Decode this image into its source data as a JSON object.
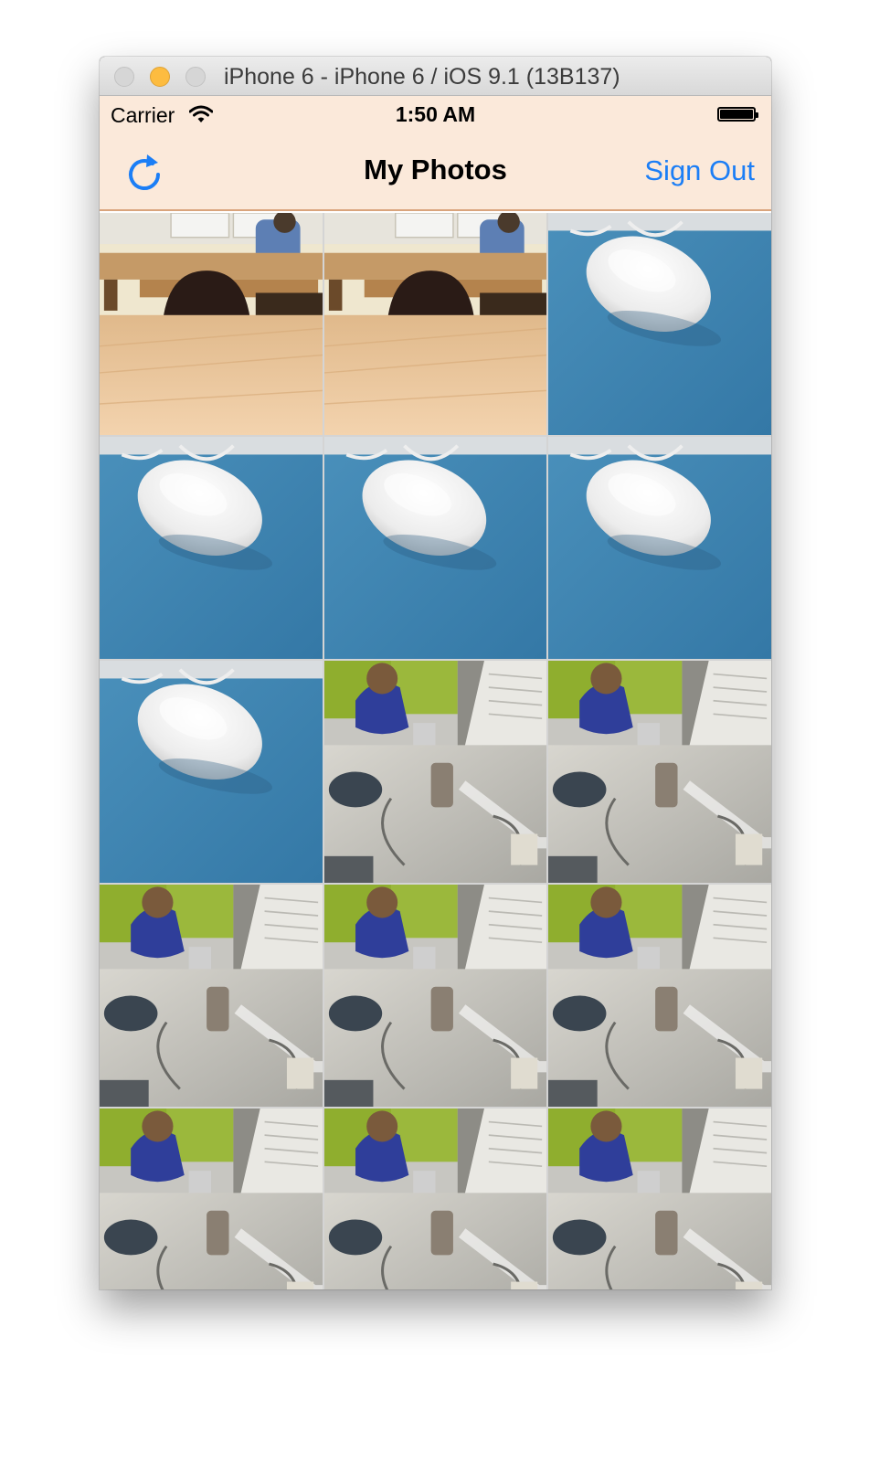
{
  "window": {
    "title": "iPhone 6 - iPhone 6 / iOS 9.1 (13B137)",
    "controls": [
      "close",
      "minimize",
      "zoom"
    ]
  },
  "status_bar": {
    "carrier": "Carrier",
    "time": "1:50 AM",
    "icons": [
      "wifi-icon",
      "battery-icon"
    ]
  },
  "nav_bar": {
    "title": "My Photos",
    "left_icon": "refresh-icon",
    "right_button": "Sign Out"
  },
  "colors": {
    "accent": "#1b7ef6",
    "nav_background": "#fbe9da",
    "nav_border": "#d9a47c",
    "minimize_light": "#fdbc40"
  },
  "photos": [
    {
      "scene": "classroom"
    },
    {
      "scene": "classroom"
    },
    {
      "scene": "mouse"
    },
    {
      "scene": "mouse"
    },
    {
      "scene": "mouse"
    },
    {
      "scene": "mouse"
    },
    {
      "scene": "mouse"
    },
    {
      "scene": "office"
    },
    {
      "scene": "office"
    },
    {
      "scene": "office"
    },
    {
      "scene": "office"
    },
    {
      "scene": "office"
    },
    {
      "scene": "office"
    },
    {
      "scene": "office"
    },
    {
      "scene": "office"
    }
  ]
}
